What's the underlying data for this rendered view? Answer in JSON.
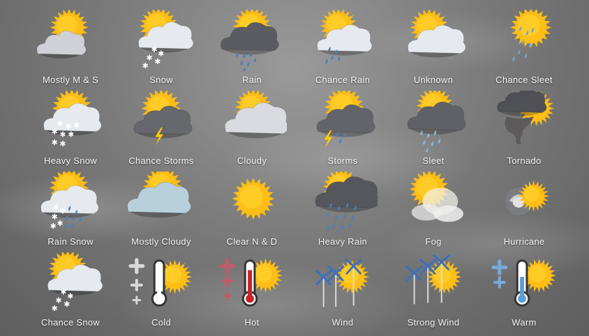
{
  "icons": [
    {
      "name": "mostly-m-s-icon",
      "label": "Mostly M & S",
      "type": "sun-smallcloud"
    },
    {
      "name": "snow-icon",
      "label": "Snow",
      "type": "sun-cloud-snow"
    },
    {
      "name": "rain-icon",
      "label": "Rain",
      "type": "sun-darkcloud-rain"
    },
    {
      "name": "chance-rain-icon",
      "label": "Chance Rain",
      "type": "sun-cloud-rain"
    },
    {
      "name": "unknown-icon",
      "label": "Unknown",
      "type": "sun-cloud"
    },
    {
      "name": "chance-sleet-icon",
      "label": "Chance Sleet",
      "type": "sun-sleet"
    },
    {
      "name": "heavy-snow-icon",
      "label": "Heavy Snow",
      "type": "sun-cloud-heavysnow"
    },
    {
      "name": "chance-storms-icon",
      "label": "Chance Storms",
      "type": "sun-darkcloud-bolt"
    },
    {
      "name": "cloudy-icon",
      "label": "Cloudy",
      "type": "sun-bigcloud"
    },
    {
      "name": "storms-icon",
      "label": "Storms",
      "type": "sun-darkcloud-bolt-rain"
    },
    {
      "name": "sleet-icon",
      "label": "Sleet",
      "type": "sun-darkcloud-sleet"
    },
    {
      "name": "tornado-icon",
      "label": "Tornado",
      "type": "tornado"
    },
    {
      "name": "rain-snow-icon",
      "label": "Rain Snow",
      "type": "sun-cloud-rainsnow"
    },
    {
      "name": "mostly-cloudy-icon",
      "label": "Mostly Cloudy",
      "type": "sun-bluecloud"
    },
    {
      "name": "clear-n-d-icon",
      "label": "Clear N & D",
      "type": "sun"
    },
    {
      "name": "heavy-rain-icon",
      "label": "Heavy Rain",
      "type": "sun-darkcloud-heavyrain"
    },
    {
      "name": "fog-icon",
      "label": "Fog",
      "type": "sun-fog"
    },
    {
      "name": "hurricane-icon",
      "label": "Hurricane",
      "type": "hurricane"
    },
    {
      "name": "chance-snow-icon",
      "label": "Chance Snow",
      "type": "sun-cloud-snow"
    },
    {
      "name": "cold-icon",
      "label": "Cold",
      "type": "thermo-cold"
    },
    {
      "name": "hot-icon",
      "label": "Hot",
      "type": "thermo-hot"
    },
    {
      "name": "wind-icon",
      "label": "Wind",
      "type": "wind"
    },
    {
      "name": "strong-wind-icon",
      "label": "Strong Wind",
      "type": "strongwind"
    },
    {
      "name": "warm-icon",
      "label": "Warm",
      "type": "thermo-warm"
    }
  ],
  "colors": {
    "sun": "#ffbe14",
    "sunCore": "#ffd634",
    "cloud": "#e6e9ee",
    "darkCloud": "#6b6c70",
    "rain": "#4a7fc1",
    "bolt": "#ffcc00",
    "red": "#c8232c",
    "label": "#f4f4f4"
  }
}
